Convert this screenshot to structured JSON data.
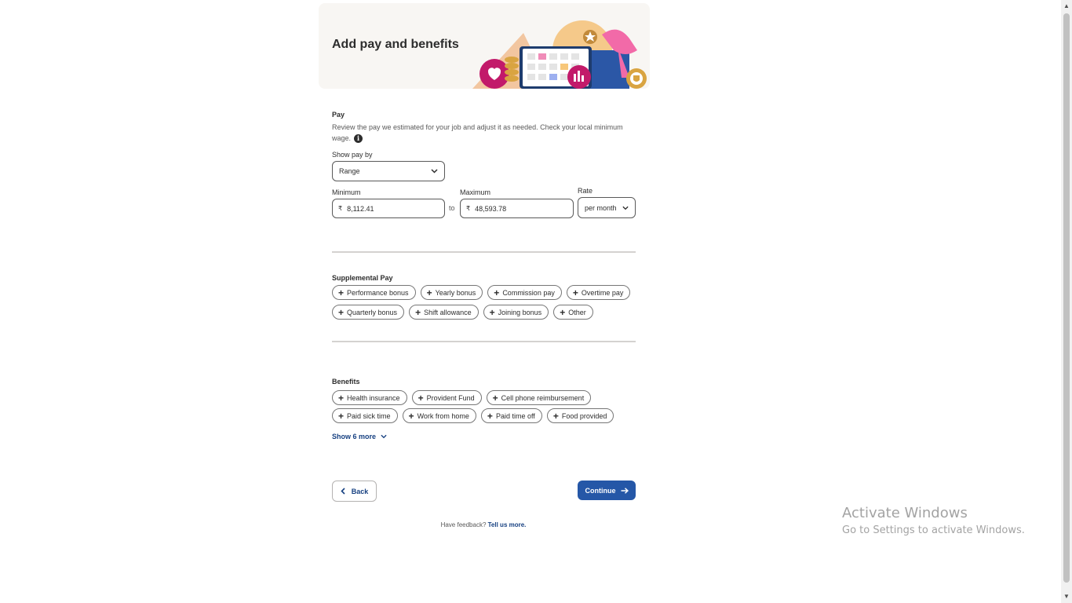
{
  "header": {
    "title": "Add pay and benefits"
  },
  "pay": {
    "title": "Pay",
    "description_line1": "Review the pay we estimated for your job and adjust it as needed. Check your local minimum",
    "description_line2": "wage.",
    "show_pay_by_label": "Show pay by",
    "show_pay_by_value": "Range",
    "minimum_label": "Minimum",
    "maximum_label": "Maximum",
    "rate_label": "Rate",
    "currency_symbol": "₹",
    "minimum_value": "8,112.41",
    "maximum_value": "48,593.78",
    "to_label": "to",
    "rate_value": "per month"
  },
  "supplemental": {
    "title": "Supplemental Pay",
    "row1": [
      "Performance bonus",
      "Yearly bonus",
      "Commission pay",
      "Overtime pay"
    ],
    "row2": [
      "Quarterly bonus",
      "Shift allowance",
      "Joining bonus",
      "Other"
    ]
  },
  "benefits": {
    "title": "Benefits",
    "row1": [
      "Health insurance",
      "Provident Fund",
      "Cell phone reimbursement"
    ],
    "row2": [
      "Paid sick time",
      "Work from home",
      "Paid time off",
      "Food provided"
    ],
    "show_more": "Show 6 more"
  },
  "nav": {
    "back": "Back",
    "continue": "Continue"
  },
  "feedback": {
    "prefix": "Have feedback?",
    "link": "Tell us more."
  },
  "watermark": {
    "line1": "Activate Windows",
    "line2": "Go to Settings to activate Windows."
  },
  "colors": {
    "primary": "#2557a7",
    "link": "#164081",
    "banner_bg": "#f8f6f3"
  }
}
